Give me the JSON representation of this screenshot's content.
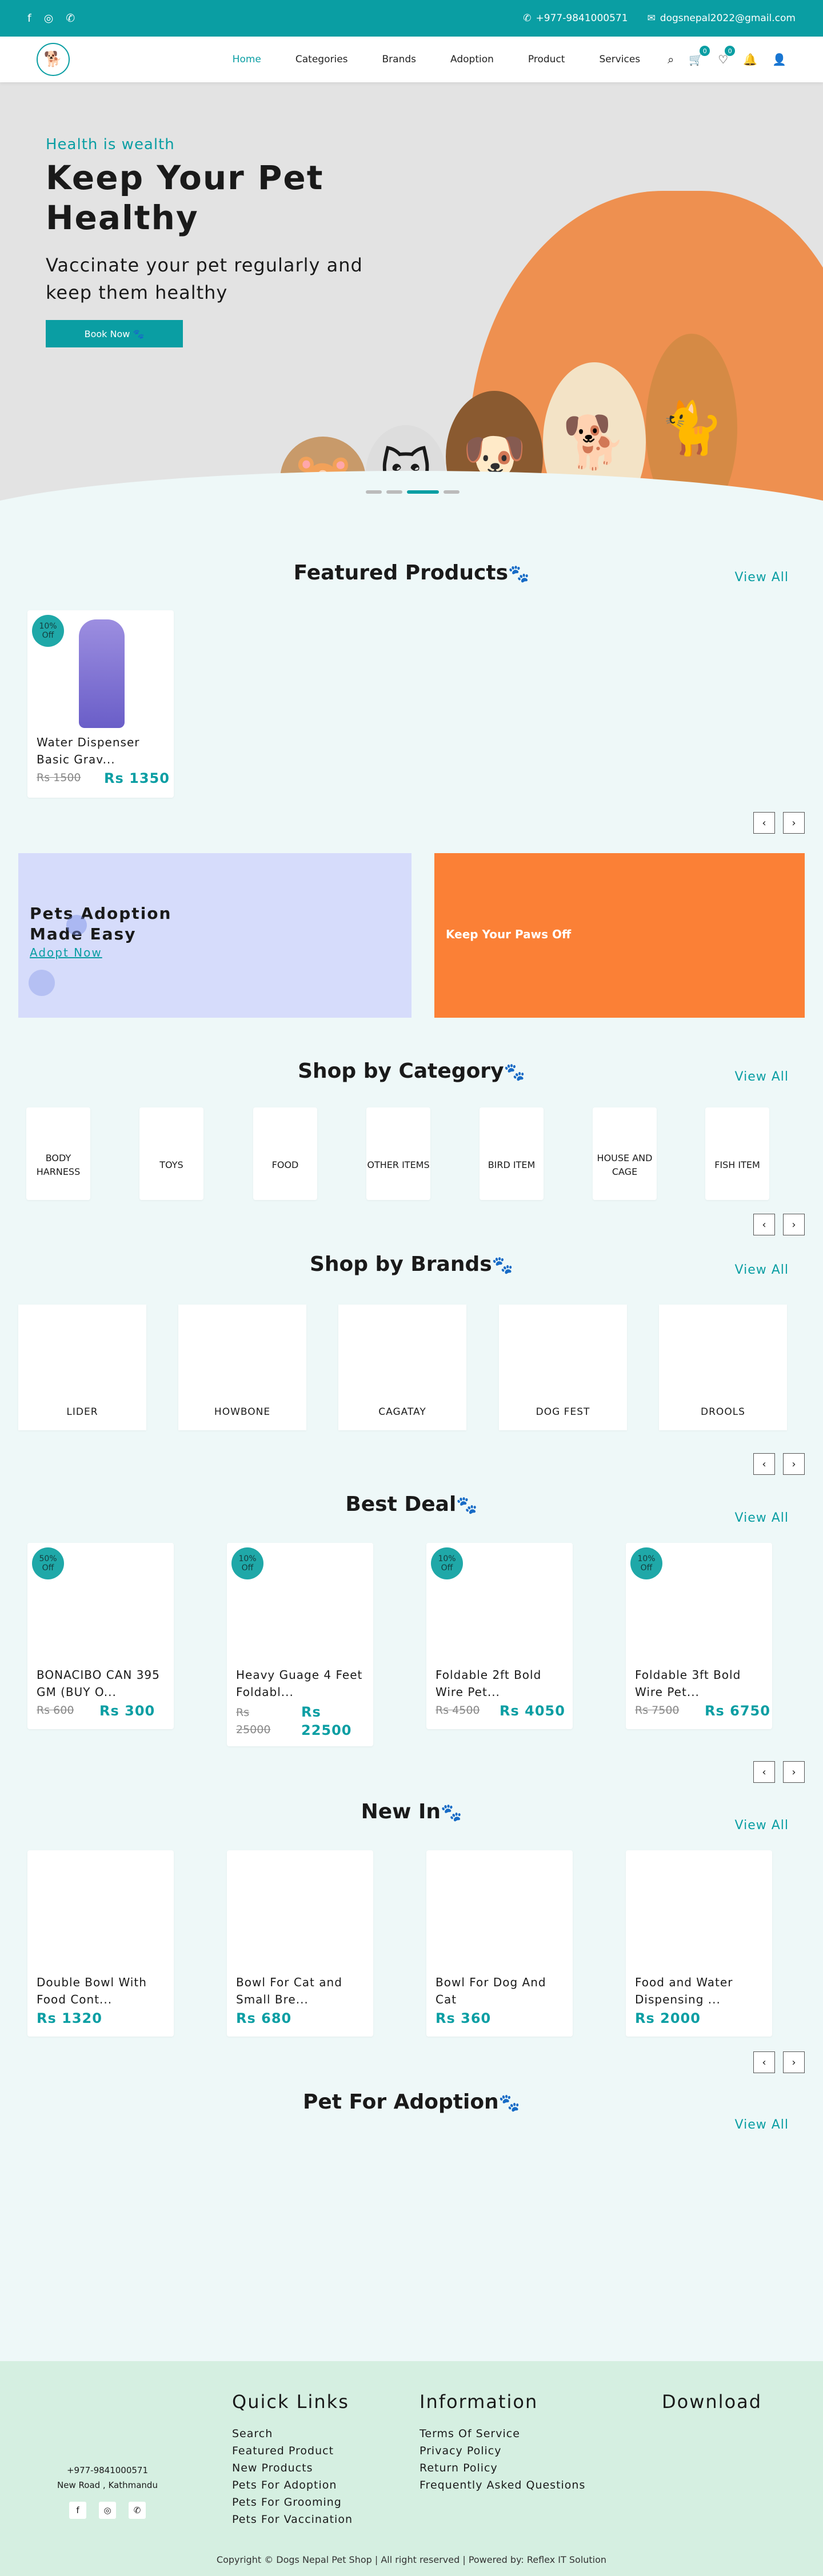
{
  "topbar": {
    "social": [
      {
        "icon": "facebook-icon",
        "glyph": "f"
      },
      {
        "icon": "instagram-icon",
        "glyph": "◎"
      },
      {
        "icon": "whatsapp-icon",
        "glyph": "✆"
      }
    ],
    "phone": "+977-9841000571",
    "email": "dogsnepal2022@gmail.com"
  },
  "nav": {
    "links": [
      "Home",
      "Categories",
      "Brands",
      "Adoption",
      "Product",
      "Services"
    ],
    "active": "Home",
    "cart_count": "0",
    "wishlist_count": "0"
  },
  "hero": {
    "kicker": "Health is wealth",
    "title": "Keep Your Pet Healthy",
    "subtitle": "Vaccinate your pet regularly and keep them healthy",
    "button": "Book Now"
  },
  "featured": {
    "title": "Featured Products",
    "view_all": "View All",
    "items": [
      {
        "discount": "10%",
        "off": "Off",
        "name": "Water Dispenser Basic Grav...",
        "old": "Rs 1500",
        "price": "Rs 1350"
      }
    ]
  },
  "promo": {
    "left_title": "Pets Adoption Made Easy",
    "left_link": "Adopt Now",
    "right_title": "Keep Your Paws Off"
  },
  "categories": {
    "title": "Shop by Category",
    "view_all": "View All",
    "items": [
      "BODY HARNESS",
      "TOYS",
      "FOOD",
      "OTHER ITEMS",
      "BIRD ITEM",
      "HOUSE AND CAGE",
      "FISH ITEM"
    ]
  },
  "brands": {
    "title": "Shop by Brands",
    "view_all": "View All",
    "items": [
      "LIDER",
      "HOWBONE",
      "CAGATAY",
      "DOG FEST",
      "DROOLS"
    ]
  },
  "best_deal": {
    "title": "Best Deal",
    "view_all": "View All",
    "items": [
      {
        "discount": "50%",
        "off": "Off",
        "name": "BONACIBO CAN 395 GM (BUY O...",
        "old": "Rs 600",
        "price": "Rs 300"
      },
      {
        "discount": "10%",
        "off": "Off",
        "name": "Heavy Guage 4 Feet Foldabl...",
        "old": "Rs 25000",
        "price": "Rs 22500"
      },
      {
        "discount": "10%",
        "off": "Off",
        "name": "Foldable 2ft Bold Wire Pet...",
        "old": "Rs 4500",
        "price": "Rs 4050"
      },
      {
        "discount": "10%",
        "off": "Off",
        "name": "Foldable 3ft Bold Wire Pet...",
        "old": "Rs 7500",
        "price": "Rs 6750"
      }
    ]
  },
  "new_in": {
    "title": "New In",
    "view_all": "View All",
    "items": [
      {
        "name": "Double Bowl With Food Cont...",
        "price": "Rs 1320"
      },
      {
        "name": "Bowl For Cat and Small Bre...",
        "price": "Rs 680"
      },
      {
        "name": "Bowl For Dog And Cat",
        "price": "Rs 360"
      },
      {
        "name": "Food and Water Dispensing ...",
        "price": "Rs 2000"
      }
    ]
  },
  "adoption": {
    "title": "Pet For Adoption",
    "view_all": "View All"
  },
  "footer": {
    "phone": "+977-9841000571",
    "address": "New Road , Kathmandu",
    "quick_links_title": "Quick Links",
    "quick_links": [
      "Search",
      "Featured Product",
      "New Products",
      "Pets For Adoption",
      "Pets For Grooming",
      "Pets For Vaccination"
    ],
    "info_title": "Information",
    "info_links": [
      "Terms Of Service",
      "Privacy Policy",
      "Return Policy",
      "Frequently Asked Questions"
    ],
    "download_title": "Download",
    "copyright": "Copyright © Dogs Nepal Pet Shop |   All right reserved |   Powered by:   Reflex IT Solution"
  }
}
